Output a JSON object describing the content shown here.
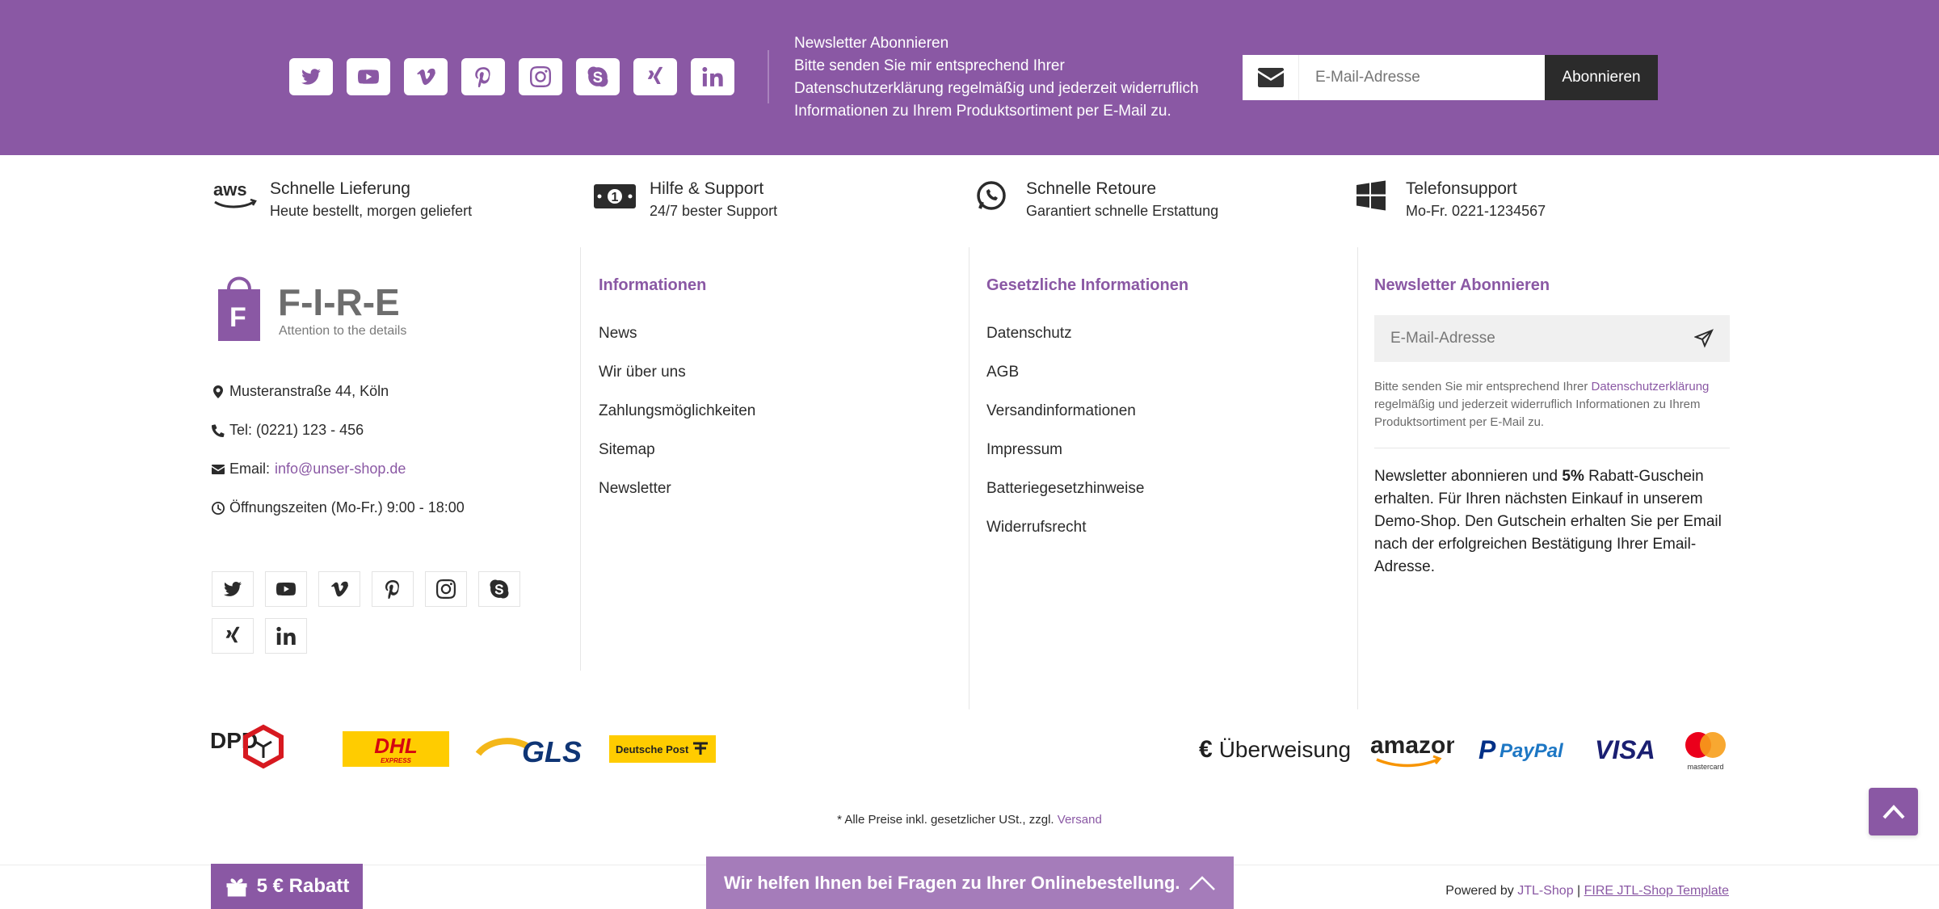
{
  "colors": {
    "accent": "#8a58a4",
    "dark": "#2b2b2b"
  },
  "top": {
    "social": [
      "twitter-icon",
      "youtube-icon",
      "vimeo-icon",
      "pinterest-icon",
      "instagram-icon",
      "skype-icon",
      "xing-icon",
      "linkedin-icon"
    ],
    "newsletter_title": "Newsletter Abonnieren",
    "newsletter_text": "Bitte senden Sie mir entsprechend Ihrer Datenschutzerklärung regelmäßig und jederzeit widerruflich Informationen zu Ihrem Produktsortiment per E-Mail zu.",
    "email_placeholder": "E-Mail-Adresse",
    "subscribe_label": "Abonnieren"
  },
  "usps": [
    {
      "title": "Schnelle Lieferung",
      "subtitle": "Heute bestellt, morgen geliefert",
      "icon": "aws-icon"
    },
    {
      "title": "Hilfe & Support",
      "subtitle": "24/7 bester Support",
      "icon": "money-bill-icon"
    },
    {
      "title": "Schnelle Retoure",
      "subtitle": "Garantiert schnelle Erstattung",
      "icon": "whatsapp-icon"
    },
    {
      "title": "Telefonsupport",
      "subtitle": "Mo-Fr. 0221-1234567",
      "icon": "windows-icon"
    }
  ],
  "company": {
    "logo_text": "F-I-R-E",
    "logo_letter": "F",
    "logo_tagline": "Attention to the details",
    "address": "Musteranstraße 44, Köln",
    "phone": "Tel: (0221) 123 - 456",
    "email_label": "Email:",
    "email": "info@unser-shop.de",
    "hours": "Öffnungszeiten (Mo-Fr.) 9:00 - 18:00",
    "social": [
      "twitter-icon",
      "youtube-icon",
      "vimeo-icon",
      "pinterest-icon",
      "instagram-icon",
      "skype-icon",
      "xing-icon",
      "linkedin-icon"
    ]
  },
  "info": {
    "title": "Informationen",
    "links": [
      "News",
      "Wir über uns",
      "Zahlungsmöglichkeiten",
      "Sitemap",
      "Newsletter"
    ]
  },
  "legal": {
    "title": "Gesetzliche Informationen",
    "links": [
      "Datenschutz",
      "AGB",
      "Versandinformationen",
      "Impressum",
      "Batteriegesetzhinweise",
      "Widerrufsrecht"
    ]
  },
  "newsletter": {
    "title": "Newsletter Abonnieren",
    "placeholder": "E-Mail-Adresse",
    "small_pre": "Bitte senden Sie mir entsprechend Ihrer",
    "small_link": "Datenschutzerklärung",
    "small_post": "regelmäßig und jederzeit widerruflich Informationen zu Ihrem Produktsortiment per E-Mail zu.",
    "promo_pre": "Newsletter abonnieren und",
    "promo_bold": "5%",
    "promo_post": "Rabatt-Guschein erhalten. Für Ihren nächsten Einkauf in unserem Demo-Shop. Den Gutschein erhalten Sie per Email nach der erfolgreichen Bestätigung Ihrer Email-Adresse."
  },
  "shipping": {
    "dpd": "DPD",
    "dhl": "DHL",
    "dhl_sub": "EXPRESS",
    "gls": "GLS",
    "post": "Deutsche Post"
  },
  "payment": {
    "euro_symbol": "€",
    "ueberweisung": "Überweisung",
    "amazon": "amazon",
    "paypal_p": "P",
    "paypal": "PayPal",
    "visa": "VISA",
    "mastercard": "mastercard"
  },
  "note": {
    "text": "* Alle Preise inkl. gesetzlicher USt., zzgl.",
    "link": "Versand"
  },
  "bottom": {
    "rabatt": "5 € Rabatt",
    "help": "Wir helfen Ihnen bei Fragen zu Ihrer Onlinebestellung.",
    "powered_pre": "Powered by",
    "powered_link": "JTL-Shop",
    "powered_sep": "|",
    "template_link": "FIRE JTL-Shop Template"
  }
}
